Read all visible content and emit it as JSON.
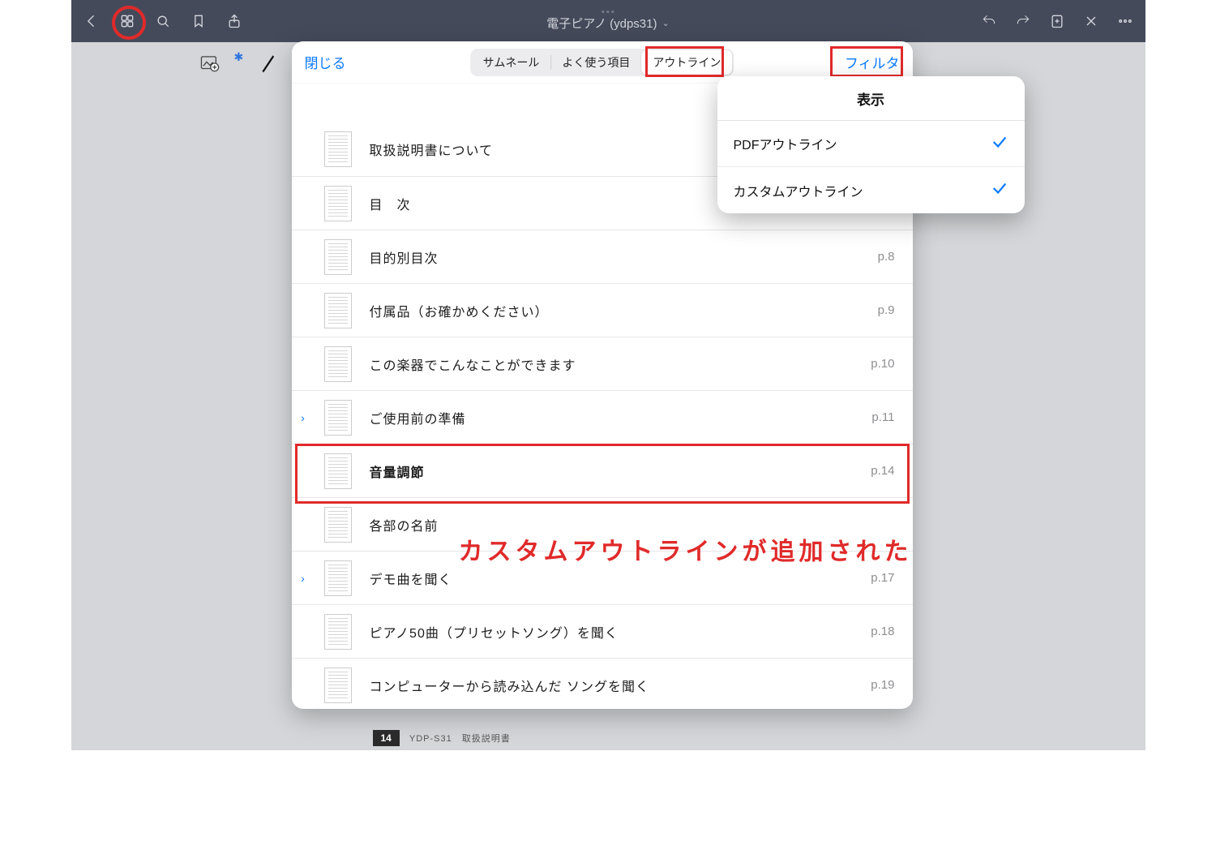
{
  "titlebar": {
    "title": "電子ピアノ (ydps31)"
  },
  "panel": {
    "close": "閉じる",
    "seg": {
      "thumbnails": "サムネール",
      "favorites": "よく使う項目",
      "outline": "アウトライン"
    },
    "filter": "フィルタ"
  },
  "outline": [
    {
      "label": "取扱説明書について",
      "page": "",
      "expand": false,
      "bold": false
    },
    {
      "label": "目　次",
      "page": "",
      "expand": false,
      "bold": false
    },
    {
      "label": "目的別目次",
      "page": "p.8",
      "expand": false,
      "bold": false
    },
    {
      "label": "付属品（お確かめください）",
      "page": "p.9",
      "expand": false,
      "bold": false
    },
    {
      "label": "この楽器でこんなことができます",
      "page": "p.10",
      "expand": false,
      "bold": false
    },
    {
      "label": "ご使用前の準備",
      "page": "p.11",
      "expand": true,
      "bold": false
    },
    {
      "label": "音量調節",
      "page": "p.14",
      "expand": false,
      "bold": true
    },
    {
      "label": "各部の名前",
      "page": "",
      "expand": false,
      "bold": false
    },
    {
      "label": "デモ曲を聞く",
      "page": "p.17",
      "expand": true,
      "bold": false
    },
    {
      "label": "ピアノ50曲（プリセットソング）を聞く",
      "page": "p.18",
      "expand": false,
      "bold": false
    },
    {
      "label": "コンピューターから読み込んだ ソングを聞く",
      "page": "p.19",
      "expand": false,
      "bold": false
    }
  ],
  "popover": {
    "title": "表示",
    "items": [
      {
        "label": "PDFアウトライン",
        "checked": true
      },
      {
        "label": "カスタムアウトライン",
        "checked": true
      }
    ]
  },
  "footer": {
    "page": "14",
    "title": "YDP-S31　取扱説明書"
  },
  "annotation": "カスタムアウトラインが追加された"
}
